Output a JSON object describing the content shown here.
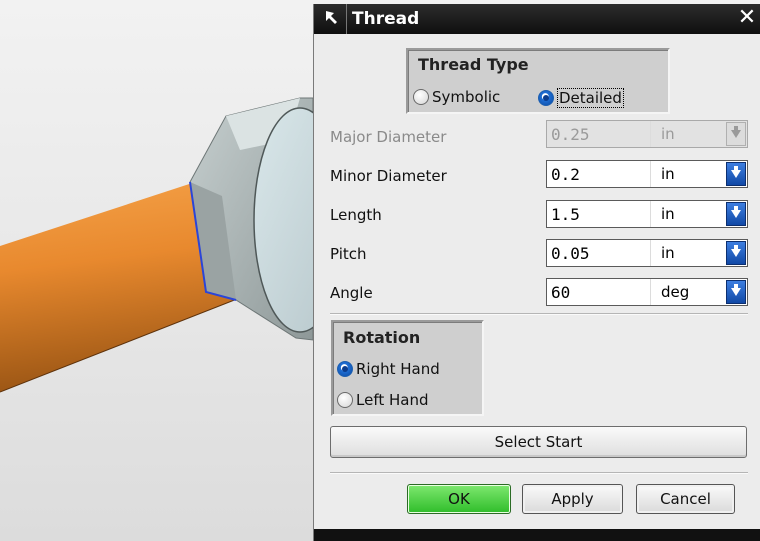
{
  "dialog": {
    "title": "Thread",
    "close_glyph": "✕"
  },
  "thread_type": {
    "title": "Thread Type",
    "options": [
      {
        "label": "Symbolic",
        "selected": false
      },
      {
        "label": "Detailed",
        "selected": true
      }
    ]
  },
  "fields": [
    {
      "label": "Major Diameter",
      "value": "0.25",
      "unit": "in",
      "enabled": false
    },
    {
      "label": "Minor Diameter",
      "value": "0.2",
      "unit": "in",
      "enabled": true
    },
    {
      "label": "Length",
      "value": "1.5",
      "unit": "in",
      "enabled": true
    },
    {
      "label": "Pitch",
      "value": "0.05",
      "unit": "in",
      "enabled": true
    },
    {
      "label": "Angle",
      "value": "60",
      "unit": "deg",
      "enabled": true
    }
  ],
  "rotation": {
    "title": "Rotation",
    "options": [
      {
        "label": "Right Hand",
        "selected": true
      },
      {
        "label": "Left Hand",
        "selected": false
      }
    ]
  },
  "select_start_label": "Select Start",
  "buttons": {
    "ok": "OK",
    "apply": "Apply",
    "cancel": "Cancel"
  },
  "colors": {
    "title_bar": "#111111",
    "rod": "#e8892e",
    "ok_button": "#3fcb35",
    "selected_radio": "#1f6fd6"
  },
  "icons": {
    "pin": "pin-icon",
    "close": "close-icon",
    "dropdown": "dropdown-arrow-icon"
  }
}
